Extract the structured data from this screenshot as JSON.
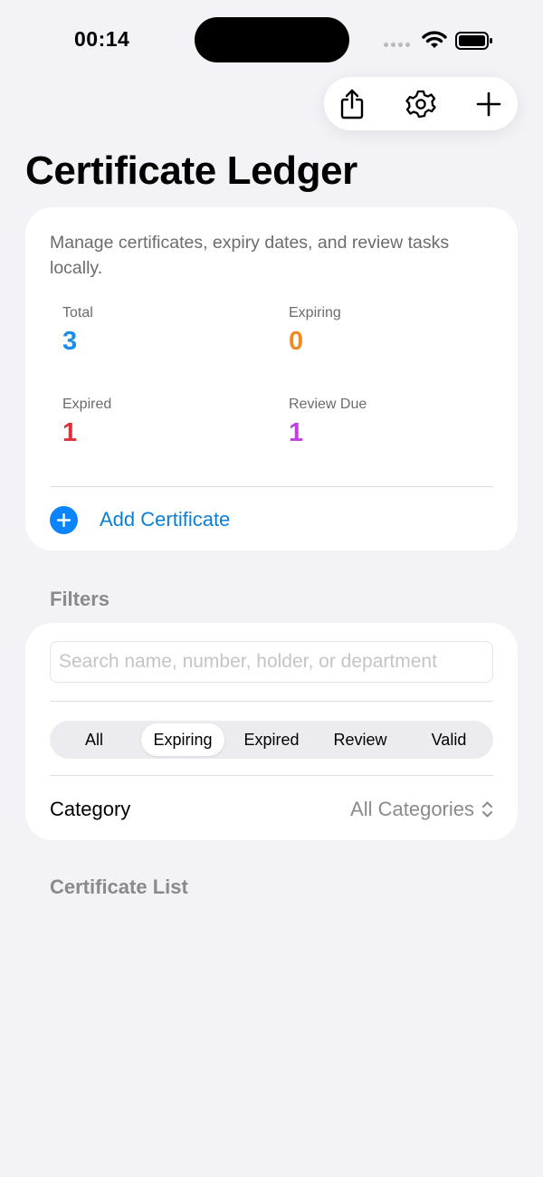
{
  "status_bar": {
    "time": "00:14"
  },
  "toolbar": {
    "share_icon": "share-icon",
    "settings_icon": "gear-icon",
    "add_icon": "plus-icon"
  },
  "page": {
    "title": "Certificate Ledger"
  },
  "summary": {
    "description": "Manage certificates, expiry dates, and review tasks locally.",
    "stats": [
      {
        "label": "Total",
        "value": "3",
        "color": "#1a8ee6"
      },
      {
        "label": "Expiring",
        "value": "0",
        "color": "#f08a24"
      },
      {
        "label": "Expired",
        "value": "1",
        "color": "#e0303a"
      },
      {
        "label": "Review Due",
        "value": "1",
        "color": "#c43ee0"
      }
    ],
    "add_button": "Add Certificate"
  },
  "filters": {
    "header": "Filters",
    "search_placeholder": "Search name, number, holder, or department",
    "segments": [
      "All",
      "Expiring",
      "Expired",
      "Review",
      "Valid"
    ],
    "selected_segment": "Expiring",
    "category_label": "Category",
    "category_value": "All Categories"
  },
  "list": {
    "header": "Certificate List"
  },
  "colors": {
    "accent": "#0a84ff",
    "background": "#f2f2f7"
  }
}
